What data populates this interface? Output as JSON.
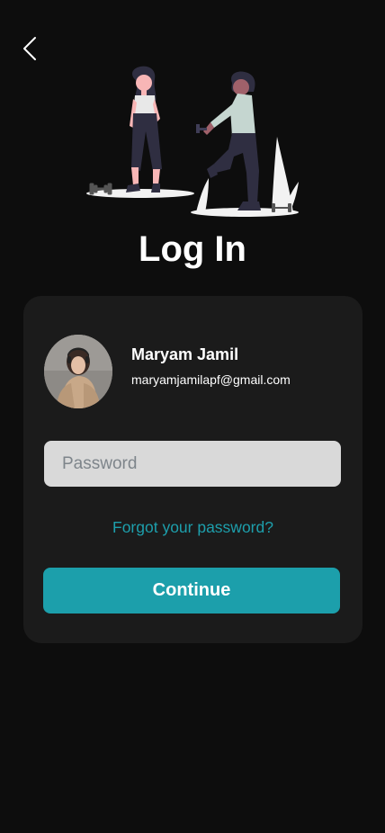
{
  "header": {
    "back_icon": "chevron-left-icon"
  },
  "illustration": {
    "name": "women-exercising-illustration"
  },
  "page": {
    "title": "Log In"
  },
  "account": {
    "name": "Maryam Jamil",
    "email": "maryamjamilapf@gmail.com"
  },
  "form": {
    "password_placeholder": "Password",
    "password_value": "",
    "forgot_label": "Forgot your password?",
    "continue_label": "Continue"
  },
  "colors": {
    "background": "#0d0d0d",
    "card": "#1b1b1b",
    "accent": "#1c9fab",
    "input_bg": "#d9d9d9",
    "text": "#ffffff"
  }
}
